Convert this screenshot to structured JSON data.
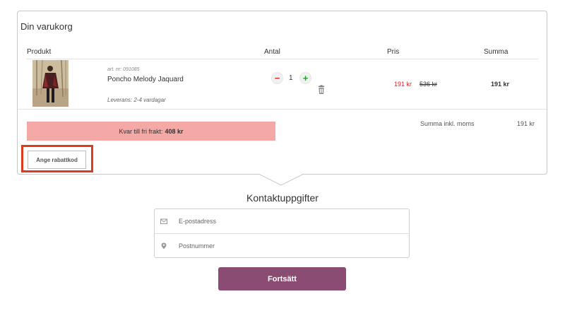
{
  "cart": {
    "title": "Din varukorg",
    "columns": {
      "product": "Produkt",
      "quantity": "Antal",
      "price": "Pris",
      "total": "Summa"
    },
    "item": {
      "art_nr": "art. nr: 091085",
      "name": "Poncho Melody Jaquard",
      "delivery": "Leverans: 2-4 vardagar",
      "quantity": "1",
      "minus_symbol": "−",
      "plus_symbol": "+",
      "price_now": "191  kr",
      "price_old": "536 kr",
      "line_total": "191  kr"
    },
    "free_shipping": {
      "label": "Kvar till fri frakt:",
      "amount": "408 kr"
    },
    "sum_label": "Summa inkl. moms",
    "sum_value": "191 kr",
    "discount_button": "Ange rabattkod"
  },
  "contact": {
    "title": "Kontaktuppgifter",
    "email_placeholder": "E-postadress",
    "zip_placeholder": "Postnummer",
    "continue_button": "Fortsätt"
  },
  "colors": {
    "accent": "#8a4c73",
    "sale_price": "#e0282c",
    "shipping_bar": "#f4a9a6",
    "highlight": "#e03a1e"
  },
  "icons": {
    "trash": "trash-icon",
    "email": "envelope-icon",
    "zip": "map-pin-icon"
  }
}
